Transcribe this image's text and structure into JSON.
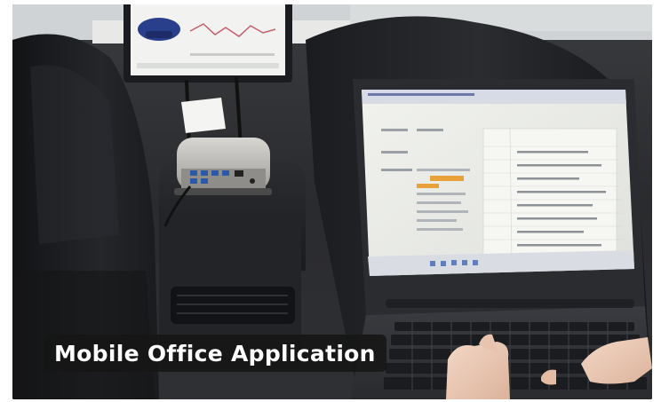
{
  "caption": {
    "text": "Mobile Office Application"
  },
  "scene": {
    "description_icon": "car-interior-photo",
    "colors": {
      "background": "#ffffff",
      "caption_bg": "#161616",
      "caption_text": "#ffffff",
      "seat_leather": "#1c1d20",
      "device_silver": "#b9b7b4",
      "laptop_body": "#2b2c30",
      "screen_light": "#e9ebe6",
      "accent_orange": "#e9a23b"
    }
  }
}
